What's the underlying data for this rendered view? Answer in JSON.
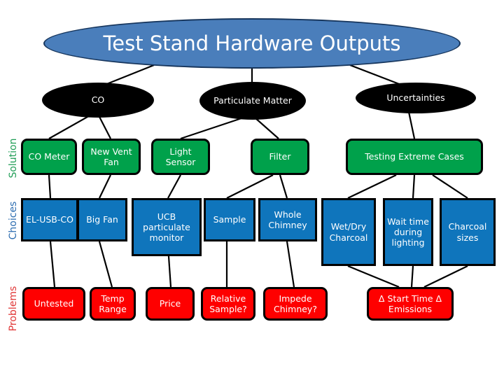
{
  "title": {
    "text": "Test Stand Hardware Outputs",
    "fill": "#4a7ebb",
    "text_color": "#ffffff"
  },
  "categories": [
    {
      "id": "co",
      "label": "CO"
    },
    {
      "id": "particulate-matter",
      "label": "Particulate Matter"
    },
    {
      "id": "uncertainties",
      "label": "Uncertainties"
    }
  ],
  "bands": [
    {
      "id": "solution",
      "label": "Solution",
      "color": "#1f9d55"
    },
    {
      "id": "choices",
      "label": "Choices",
      "color": "#2b6cb0"
    },
    {
      "id": "problems",
      "label": "Problems",
      "color": "#e03535"
    }
  ],
  "colors": {
    "solution_fill": "#00a14b",
    "choices_fill": "#0f75bc",
    "problems_fill": "#fe0000",
    "ellipse_fill": "#000000",
    "connector": "#000000"
  },
  "solution_nodes": [
    {
      "id": "co-meter",
      "label": "CO Meter"
    },
    {
      "id": "new-vent-fan",
      "label": "New Vent Fan"
    },
    {
      "id": "light-sensor",
      "label": "Light Sensor"
    },
    {
      "id": "filter",
      "label": "Filter"
    },
    {
      "id": "testing-extreme-cases",
      "label": "Testing Extreme Cases"
    }
  ],
  "choice_nodes": [
    {
      "id": "el-usb-co",
      "label": "EL-USB-CO"
    },
    {
      "id": "big-fan",
      "label": "Big Fan"
    },
    {
      "id": "ucb-particulate-monitor",
      "label": "UCB particulate monitor"
    },
    {
      "id": "sample",
      "label": "Sample"
    },
    {
      "id": "whole-chimney",
      "label": "Whole Chimney"
    },
    {
      "id": "wet-dry-charcoal",
      "label": "Wet/Dry Charcoal"
    },
    {
      "id": "wait-time-during-lighting",
      "label": "Wait time during lighting"
    },
    {
      "id": "charcoal-sizes",
      "label": "Charcoal sizes"
    }
  ],
  "problem_nodes": [
    {
      "id": "untested",
      "label": "Untested"
    },
    {
      "id": "temp-range",
      "label": "Temp Range"
    },
    {
      "id": "price",
      "label": "Price"
    },
    {
      "id": "relative-sample",
      "label": "Relative Sample?"
    },
    {
      "id": "impede-chimney",
      "label": "Impede Chimney?"
    },
    {
      "id": "delta-start-time-emissions",
      "label": "Δ Start Time Δ Emissions"
    }
  ]
}
